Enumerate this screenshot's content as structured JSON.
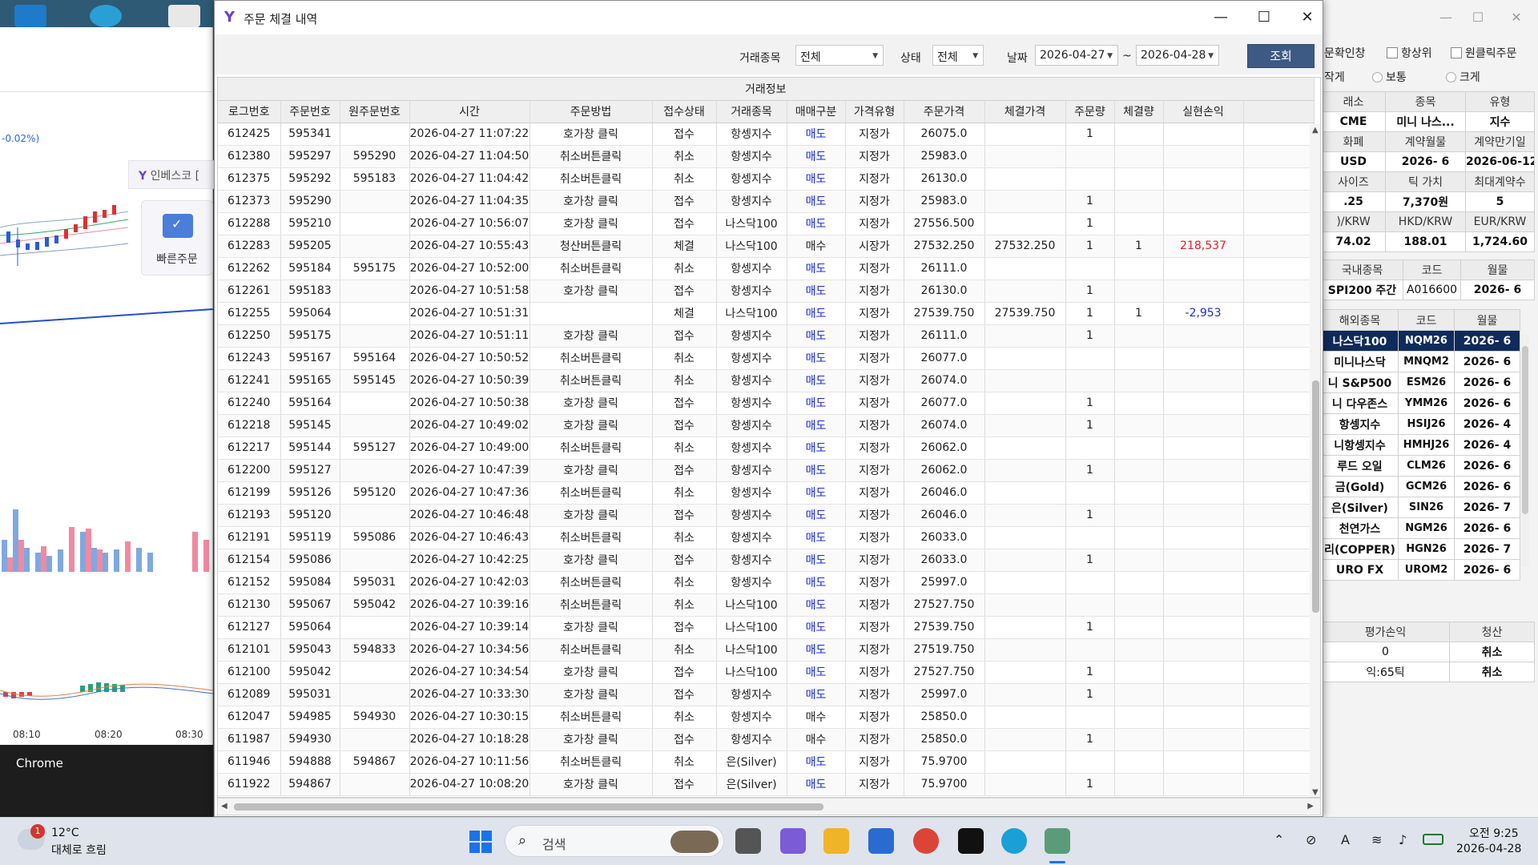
{
  "window": {
    "title": "주문 체결 내역"
  },
  "filters": {
    "item_label": "거래종목",
    "item_value": "전체",
    "status_label": "상태",
    "status_value": "전체",
    "date_label": "날짜",
    "date_from": "2026-04-27",
    "date_sep": "~",
    "date_to": "2026-04-28",
    "search_button": "조회"
  },
  "grid": {
    "group_header": "거래정보",
    "columns": [
      "로그번호",
      "주문번호",
      "원주문번호",
      "시간",
      "주문방법",
      "접수상태",
      "거래종목",
      "매매구분",
      "가격유형",
      "주문가격",
      "체결가격",
      "주문량",
      "체결량",
      "실현손익"
    ],
    "rows": [
      [
        "612425",
        "595341",
        "",
        "2026-04-27 11:07:22",
        "호가창 클릭",
        "접수",
        "항셍지수",
        "매도",
        "지정가",
        "26075.0",
        "",
        "1",
        "",
        ""
      ],
      [
        "612380",
        "595297",
        "595290",
        "2026-04-27 11:04:50",
        "취소버튼클릭",
        "취소",
        "항셍지수",
        "매도",
        "지정가",
        "25983.0",
        "",
        "",
        "",
        ""
      ],
      [
        "612375",
        "595292",
        "595183",
        "2026-04-27 11:04:42",
        "취소버튼클릭",
        "취소",
        "항셍지수",
        "매도",
        "지정가",
        "26130.0",
        "",
        "",
        "",
        ""
      ],
      [
        "612373",
        "595290",
        "",
        "2026-04-27 11:04:35",
        "호가창 클릭",
        "접수",
        "항셍지수",
        "매도",
        "지정가",
        "25983.0",
        "",
        "1",
        "",
        ""
      ],
      [
        "612288",
        "595210",
        "",
        "2026-04-27 10:56:07",
        "호가창 클릭",
        "접수",
        "나스닥100",
        "매도",
        "지정가",
        "27556.500",
        "",
        "1",
        "",
        ""
      ],
      [
        "612283",
        "595205",
        "",
        "2026-04-27 10:55:43",
        "청산버튼클릭",
        "체결",
        "나스닥100",
        "매수",
        "시장가",
        "27532.250",
        "27532.250",
        "1",
        "1",
        "218,537"
      ],
      [
        "612262",
        "595184",
        "595175",
        "2026-04-27 10:52:00",
        "취소버튼클릭",
        "취소",
        "항셍지수",
        "매도",
        "지정가",
        "26111.0",
        "",
        "",
        "",
        ""
      ],
      [
        "612261",
        "595183",
        "",
        "2026-04-27 10:51:58",
        "호가창 클릭",
        "접수",
        "항셍지수",
        "매도",
        "지정가",
        "26130.0",
        "",
        "1",
        "",
        ""
      ],
      [
        "612255",
        "595064",
        "",
        "2026-04-27 10:51:31",
        "",
        "체결",
        "나스닥100",
        "매도",
        "지정가",
        "27539.750",
        "27539.750",
        "1",
        "1",
        "-2,953"
      ],
      [
        "612250",
        "595175",
        "",
        "2026-04-27 10:51:11",
        "호가창 클릭",
        "접수",
        "항셍지수",
        "매도",
        "지정가",
        "26111.0",
        "",
        "1",
        "",
        ""
      ],
      [
        "612243",
        "595167",
        "595164",
        "2026-04-27 10:50:52",
        "취소버튼클릭",
        "취소",
        "항셍지수",
        "매도",
        "지정가",
        "26077.0",
        "",
        "",
        "",
        ""
      ],
      [
        "612241",
        "595165",
        "595145",
        "2026-04-27 10:50:39",
        "취소버튼클릭",
        "취소",
        "항셍지수",
        "매도",
        "지정가",
        "26074.0",
        "",
        "",
        "",
        ""
      ],
      [
        "612240",
        "595164",
        "",
        "2026-04-27 10:50:38",
        "호가창 클릭",
        "접수",
        "항셍지수",
        "매도",
        "지정가",
        "26077.0",
        "",
        "1",
        "",
        ""
      ],
      [
        "612218",
        "595145",
        "",
        "2026-04-27 10:49:02",
        "호가창 클릭",
        "접수",
        "항셍지수",
        "매도",
        "지정가",
        "26074.0",
        "",
        "1",
        "",
        ""
      ],
      [
        "612217",
        "595144",
        "595127",
        "2026-04-27 10:49:00",
        "취소버튼클릭",
        "취소",
        "항셍지수",
        "매도",
        "지정가",
        "26062.0",
        "",
        "",
        "",
        ""
      ],
      [
        "612200",
        "595127",
        "",
        "2026-04-27 10:47:39",
        "호가창 클릭",
        "접수",
        "항셍지수",
        "매도",
        "지정가",
        "26062.0",
        "",
        "1",
        "",
        ""
      ],
      [
        "612199",
        "595126",
        "595120",
        "2026-04-27 10:47:36",
        "취소버튼클릭",
        "취소",
        "항셍지수",
        "매도",
        "지정가",
        "26046.0",
        "",
        "",
        "",
        ""
      ],
      [
        "612193",
        "595120",
        "",
        "2026-04-27 10:46:48",
        "호가창 클릭",
        "접수",
        "항셍지수",
        "매도",
        "지정가",
        "26046.0",
        "",
        "1",
        "",
        ""
      ],
      [
        "612191",
        "595119",
        "595086",
        "2026-04-27 10:46:43",
        "취소버튼클릭",
        "취소",
        "항셍지수",
        "매도",
        "지정가",
        "26033.0",
        "",
        "",
        "",
        ""
      ],
      [
        "612154",
        "595086",
        "",
        "2026-04-27 10:42:25",
        "호가창 클릭",
        "접수",
        "항셍지수",
        "매도",
        "지정가",
        "26033.0",
        "",
        "1",
        "",
        ""
      ],
      [
        "612152",
        "595084",
        "595031",
        "2026-04-27 10:42:03",
        "취소버튼클릭",
        "취소",
        "항셍지수",
        "매도",
        "지정가",
        "25997.0",
        "",
        "",
        "",
        ""
      ],
      [
        "612130",
        "595067",
        "595042",
        "2026-04-27 10:39:16",
        "취소버튼클릭",
        "취소",
        "나스닥100",
        "매도",
        "지정가",
        "27527.750",
        "",
        "",
        "",
        ""
      ],
      [
        "612127",
        "595064",
        "",
        "2026-04-27 10:39:14",
        "호가창 클릭",
        "접수",
        "나스닥100",
        "매도",
        "지정가",
        "27539.750",
        "",
        "1",
        "",
        ""
      ],
      [
        "612101",
        "595043",
        "594833",
        "2026-04-27 10:34:56",
        "취소버튼클릭",
        "취소",
        "나스닥100",
        "매도",
        "지정가",
        "27519.750",
        "",
        "",
        "",
        ""
      ],
      [
        "612100",
        "595042",
        "",
        "2026-04-27 10:34:54",
        "호가창 클릭",
        "접수",
        "나스닥100",
        "매도",
        "지정가",
        "27527.750",
        "",
        "1",
        "",
        ""
      ],
      [
        "612089",
        "595031",
        "",
        "2026-04-27 10:33:30",
        "호가창 클릭",
        "접수",
        "항셍지수",
        "매도",
        "지정가",
        "25997.0",
        "",
        "1",
        "",
        ""
      ],
      [
        "612047",
        "594985",
        "594930",
        "2026-04-27 10:30:15",
        "취소버튼클릭",
        "취소",
        "항셍지수",
        "매수",
        "지정가",
        "25850.0",
        "",
        "",
        "",
        ""
      ],
      [
        "611987",
        "594930",
        "",
        "2026-04-27 10:18:28",
        "호가창 클릭",
        "접수",
        "항셍지수",
        "매수",
        "지정가",
        "25850.0",
        "",
        "1",
        "",
        ""
      ],
      [
        "611946",
        "594888",
        "594867",
        "2026-04-27 10:11:56",
        "취소버튼클릭",
        "취소",
        "은(Silver)",
        "매도",
        "지정가",
        "75.9700",
        "",
        "",
        "",
        ""
      ],
      [
        "611922",
        "594867",
        "",
        "2026-04-27 10:08:20",
        "호가창 클릭",
        "접수",
        "은(Silver)",
        "매도",
        "지정가",
        "75.9700",
        "",
        "1",
        "",
        ""
      ]
    ]
  },
  "left_app": {
    "change_pct": "-0.02%)",
    "badge_text": "인베스코 [",
    "quick_order": "빠른주문",
    "time_ticks": [
      "08:10",
      "08:20",
      "08:30"
    ],
    "chrome_label": "Chrome"
  },
  "right_panel": {
    "top_checks": {
      "confirm": "문확인창",
      "always_top": "항상위",
      "one_click": "원클릭주문"
    },
    "size_opts": {
      "small": "작게",
      "normal": "보통",
      "large": "크게"
    },
    "info_rows": [
      [
        "래소",
        "종목",
        "유형"
      ],
      [
        "CME",
        "미니 나스...",
        "지수"
      ],
      [
        "화폐",
        "계약월물",
        "계약만기일"
      ],
      [
        "USD",
        "2026- 6",
        "2026-06-12"
      ],
      [
        "사이즈",
        "틱 가치",
        "최대계약수"
      ],
      [
        ".25",
        "7,370원",
        "5"
      ],
      [
        ")/KRW",
        "HKD/KRW",
        "EUR/KRW"
      ],
      [
        "74.02",
        "188.01",
        "1,724.60"
      ]
    ],
    "domestic": {
      "headers": [
        "국내종목",
        "코드",
        "월물"
      ],
      "row": [
        "SPI200 주간",
        "A016600",
        "2026- 6"
      ]
    },
    "foreign": {
      "headers": [
        "해외종목",
        "코드",
        "월물"
      ],
      "rows": [
        [
          "나스닥100",
          "NQM26",
          "2026- 6"
        ],
        [
          "미니나스닥",
          "MNQM2",
          "2026- 6"
        ],
        [
          "니 S&P500",
          "ESM26",
          "2026- 6"
        ],
        [
          "니 다우존스",
          "YMM26",
          "2026- 6"
        ],
        [
          "항셍지수",
          "HSIJ26",
          "2026- 4"
        ],
        [
          "니항셍지수",
          "HMHJ26",
          "2026- 4"
        ],
        [
          "루드 오일",
          "CLM26",
          "2026- 6"
        ],
        [
          "금(Gold)",
          "GCM26",
          "2026- 6"
        ],
        [
          "은(Silver)",
          "SIN26",
          "2026- 7"
        ],
        [
          "천연가스",
          "NGM26",
          "2026- 6"
        ],
        [
          "리(COPPER)",
          "HGN26",
          "2026- 7"
        ],
        [
          "URO FX",
          "UROM2",
          "2026- 6"
        ]
      ]
    },
    "eval": {
      "header_pl": "평가손익",
      "header_close": "청산",
      "pl_value": "0",
      "tick_value": "익:65틱",
      "cancel1": "취소",
      "cancel2": "취소"
    }
  },
  "taskbar": {
    "weather_badge": "1",
    "temp": "12°C",
    "weather_desc": "대체로 흐림",
    "search_placeholder": "검색",
    "time": "오전 9:25",
    "date": "2026-04-28"
  }
}
